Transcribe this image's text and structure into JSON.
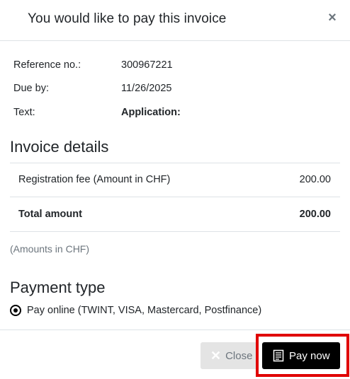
{
  "modal": {
    "title": "You would like to pay this invoice",
    "close_symbol": "×"
  },
  "info": [
    {
      "label": "Reference no.:",
      "value": "300967221"
    },
    {
      "label": "Due by:",
      "value": "11/26/2025"
    },
    {
      "label": "Text:",
      "value": "Application:"
    }
  ],
  "invoice_details": {
    "title": "Invoice details",
    "rows": [
      {
        "description": "Registration fee (Amount in CHF)",
        "amount": "200.00"
      }
    ],
    "total": {
      "label": "Total amount",
      "amount": "200.00"
    },
    "note": "(Amounts in CHF)"
  },
  "payment_type": {
    "title": "Payment type",
    "options": [
      {
        "label": "Pay online (TWINT, VISA, Mastercard, Postfinance)",
        "selected": true
      }
    ]
  },
  "footer": {
    "close_label": "Close",
    "close_icon": "x-icon",
    "pay_label": "Pay now",
    "pay_icon": "receipt-icon"
  },
  "colors": {
    "highlight": "#e00000",
    "pay_button": "#000000",
    "close_button": "#e4e4e4"
  }
}
